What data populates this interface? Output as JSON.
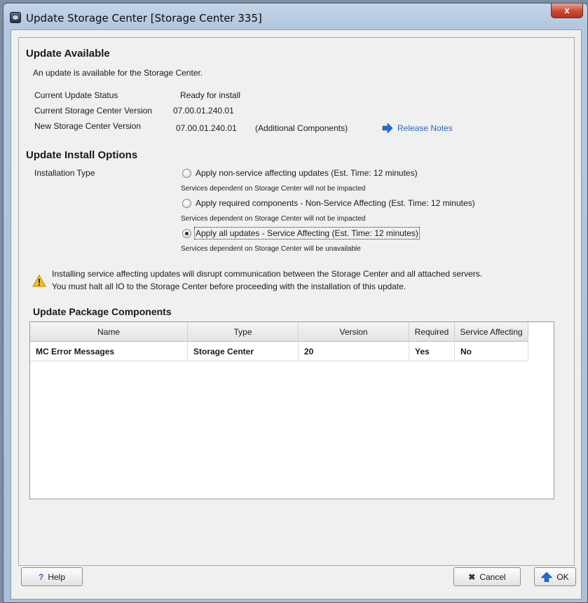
{
  "window": {
    "title": "Update Storage Center [Storage Center 335]",
    "close_glyph": "x"
  },
  "update_available": {
    "heading": "Update Available",
    "description": "An update is available for the Storage Center.",
    "current_status_label": "Current Update Status",
    "current_status_value": "Ready for install",
    "current_version_label": "Current Storage Center Version",
    "current_version_value": "07.00.01.240.01",
    "new_version_label": "New Storage Center Version",
    "new_version_value": "07.00.01.240.01",
    "new_version_note": "(Additional Components)",
    "release_notes_link": "Release Notes",
    "release_notes_icon": "arrow-right-icon"
  },
  "install_options": {
    "heading": "Update Install Options",
    "installation_type_label": "Installation Type",
    "options": [
      {
        "label": "Apply non-service affecting updates (Est. Time: 12 minutes)",
        "note": "Services dependent on Storage Center will not be impacted",
        "selected": false
      },
      {
        "label": "Apply required components - Non-Service Affecting (Est. Time: 12 minutes)",
        "note": "Services dependent on Storage Center will not be impacted",
        "selected": false
      },
      {
        "label": "Apply all updates - Service Affecting (Est. Time: 12 minutes)",
        "note": "Services dependent on Storage Center will be unavailable",
        "selected": true
      }
    ]
  },
  "warning": {
    "icon": "warning-icon",
    "line1": "Installing service affecting updates will disrupt communication between the Storage Center and all attached servers.",
    "line2": "You must halt all IO to the Storage Center before proceeding with the installation of this update."
  },
  "components": {
    "heading": "Update Package Components",
    "columns": [
      "Name",
      "Type",
      "Version",
      "Required",
      "Service Affecting"
    ],
    "rows": [
      [
        "MC Error Messages",
        "Storage Center",
        "20",
        "Yes",
        "No"
      ]
    ]
  },
  "footer": {
    "help_label": "Help",
    "help_icon": "question-icon",
    "cancel_label": "Cancel",
    "cancel_icon": "x-icon",
    "ok_label": "OK",
    "ok_icon": "up-arrow-icon"
  },
  "colors": {
    "link": "#2a66c4",
    "accent_blue": "#1e6fd6",
    "warning_yellow": "#f2c01c",
    "close_red": "#c84a33"
  }
}
